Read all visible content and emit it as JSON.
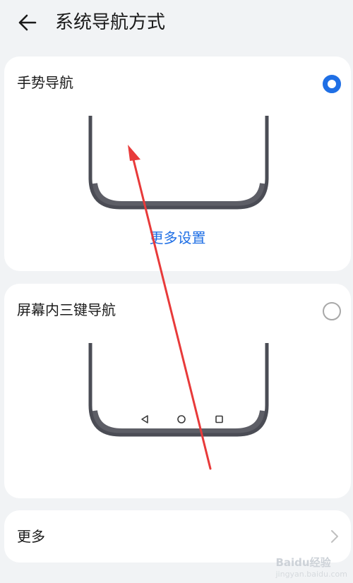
{
  "header": {
    "title": "系统导航方式",
    "back_icon": "arrow-left-icon"
  },
  "options": [
    {
      "label": "手势导航",
      "selected": true,
      "link": "更多设置"
    },
    {
      "label": "屏幕内三键导航",
      "selected": false,
      "nav_icons": [
        "back-triangle-icon",
        "home-circle-icon",
        "recents-square-icon"
      ]
    }
  ],
  "more": {
    "label": "更多",
    "icon": "chevron-right-icon"
  },
  "colors": {
    "accent": "#1f6fe5",
    "card_bg": "#ffffff",
    "page_bg": "#f1f3f5",
    "phone_frame": "#4b4d55",
    "annotation_arrow": "#e83a3a"
  },
  "watermark": {
    "brand": "Baidu经验",
    "sub": "jingyan.baidu.com"
  }
}
